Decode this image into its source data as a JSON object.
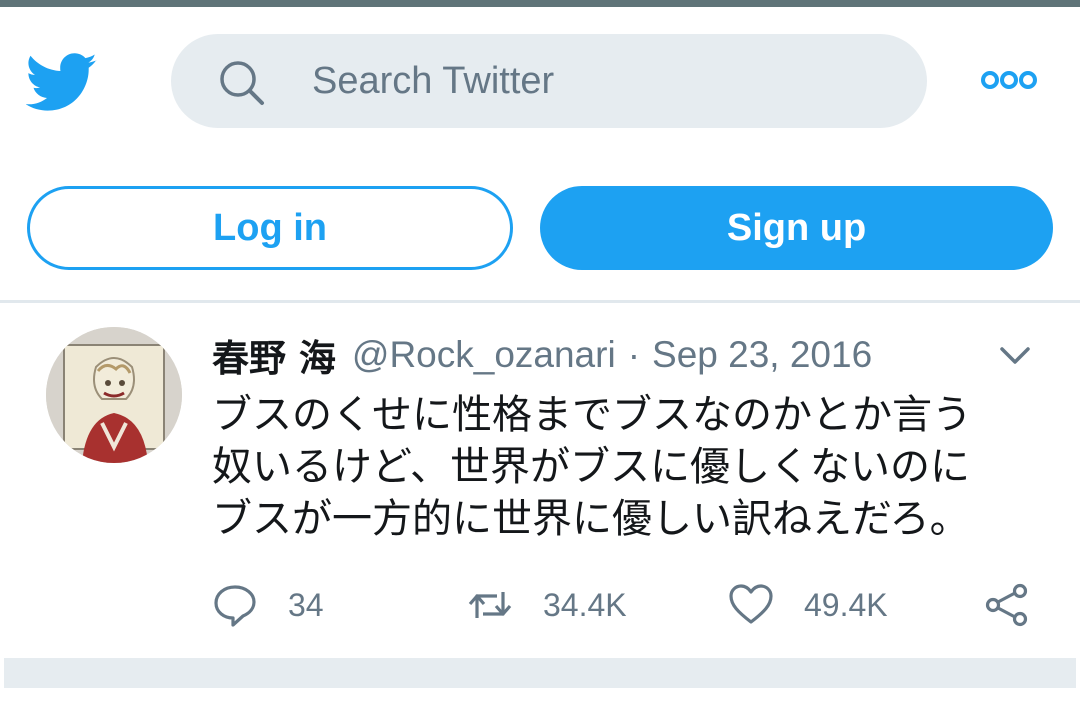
{
  "header": {
    "search_placeholder": "Search Twitter",
    "brand_color": "#1da1f2",
    "icons": [
      "twitter-bird-icon",
      "search-icon",
      "more-icon"
    ]
  },
  "auth": {
    "login_label": "Log in",
    "signup_label": "Sign up"
  },
  "tweet": {
    "display_name": "春野 海",
    "handle": "@Rock_ozanari",
    "separator": "·",
    "date": "Sep 23, 2016",
    "text": "ブスのくせに性格までブスなのかとか言う\n奴いるけど、世界がブスに優しくないのに\nブスが一方的に世界に優しい訳ねえだろ。",
    "replies": "34",
    "retweets": "34.4K",
    "likes": "49.4K",
    "action_icons": [
      "reply-icon",
      "retweet-icon",
      "like-icon",
      "share-icon"
    ],
    "menu_icon": "chevron-down-icon"
  },
  "colors": {
    "accent": "#1da1f2",
    "muted_text": "#657786",
    "search_bg": "#e6ecf0",
    "divider": "#e1e8ed"
  }
}
